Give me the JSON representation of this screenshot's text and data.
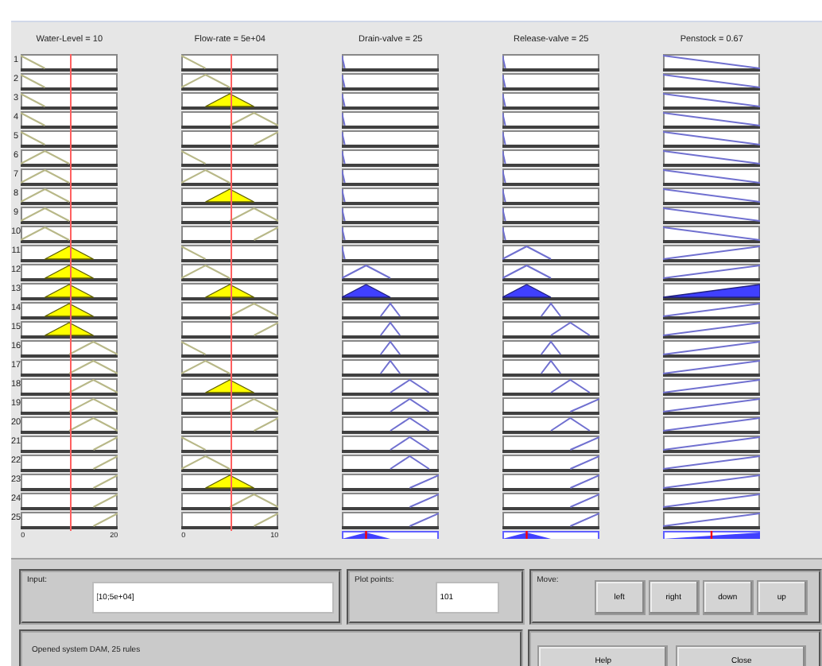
{
  "rule_numbers": [
    "1",
    "2",
    "3",
    "4",
    "5",
    "6",
    "7",
    "8",
    "9",
    "10",
    "11",
    "12",
    "13",
    "14",
    "15",
    "16",
    "17",
    "18",
    "19",
    "20",
    "21",
    "22",
    "23",
    "24",
    "25"
  ],
  "columns": [
    {
      "title": "Water-Level = 10",
      "kind": "input",
      "axis_min": "0",
      "axis_max": "20",
      "rules": [
        {
          "kind": "z",
          "fired": false
        },
        {
          "kind": "z",
          "fired": false
        },
        {
          "kind": "z",
          "fired": false
        },
        {
          "kind": "z",
          "fired": false
        },
        {
          "kind": "z",
          "fired": false
        },
        {
          "kind": "tl",
          "fired": false
        },
        {
          "kind": "tl",
          "fired": false
        },
        {
          "kind": "tl",
          "fired": false
        },
        {
          "kind": "tl",
          "fired": false
        },
        {
          "kind": "tl",
          "fired": false
        },
        {
          "kind": "tm",
          "fired": true
        },
        {
          "kind": "tm",
          "fired": true
        },
        {
          "kind": "tm",
          "fired": true
        },
        {
          "kind": "tm",
          "fired": true
        },
        {
          "kind": "tm",
          "fired": true
        },
        {
          "kind": "tr",
          "fired": false
        },
        {
          "kind": "tr",
          "fired": false
        },
        {
          "kind": "tr",
          "fired": false
        },
        {
          "kind": "tr",
          "fired": false
        },
        {
          "kind": "tr",
          "fired": false
        },
        {
          "kind": "s",
          "fired": false
        },
        {
          "kind": "s",
          "fired": false
        },
        {
          "kind": "s",
          "fired": false
        },
        {
          "kind": "s",
          "fired": false
        },
        {
          "kind": "s",
          "fired": false
        }
      ]
    },
    {
      "title": "Flow-rate = 5e+04",
      "kind": "input",
      "axis_min": "0",
      "axis_max": "10",
      "rules": [
        {
          "kind": "z",
          "fired": false
        },
        {
          "kind": "tl",
          "fired": false
        },
        {
          "kind": "tm",
          "fired": true
        },
        {
          "kind": "tr",
          "fired": false
        },
        {
          "kind": "s",
          "fired": false
        },
        {
          "kind": "z",
          "fired": false
        },
        {
          "kind": "tl",
          "fired": false
        },
        {
          "kind": "tm",
          "fired": true
        },
        {
          "kind": "tr",
          "fired": false
        },
        {
          "kind": "s",
          "fired": false
        },
        {
          "kind": "z",
          "fired": false
        },
        {
          "kind": "tl",
          "fired": false
        },
        {
          "kind": "tm",
          "fired": true
        },
        {
          "kind": "tr",
          "fired": false
        },
        {
          "kind": "s",
          "fired": false
        },
        {
          "kind": "z",
          "fired": false
        },
        {
          "kind": "tl",
          "fired": false
        },
        {
          "kind": "tm",
          "fired": true
        },
        {
          "kind": "tr",
          "fired": false
        },
        {
          "kind": "s",
          "fired": false
        },
        {
          "kind": "z",
          "fired": false
        },
        {
          "kind": "tl",
          "fired": false
        },
        {
          "kind": "tm",
          "fired": true
        },
        {
          "kind": "tr",
          "fired": false
        },
        {
          "kind": "s",
          "fired": false
        }
      ]
    },
    {
      "title": "Drain-valve = 25",
      "kind": "output",
      "rules": [
        {
          "kind": "spike",
          "fired": false
        },
        {
          "kind": "spike",
          "fired": false
        },
        {
          "kind": "spike",
          "fired": false
        },
        {
          "kind": "spike",
          "fired": false
        },
        {
          "kind": "spike",
          "fired": false
        },
        {
          "kind": "spike",
          "fired": false
        },
        {
          "kind": "spike",
          "fired": false
        },
        {
          "kind": "spike",
          "fired": false
        },
        {
          "kind": "spike",
          "fired": false
        },
        {
          "kind": "spike",
          "fired": false
        },
        {
          "kind": "spike",
          "fired": false
        },
        {
          "kind": "low",
          "fired": false
        },
        {
          "kind": "low",
          "fired": true
        },
        {
          "kind": "narrow",
          "fired": false
        },
        {
          "kind": "narrow",
          "fired": false
        },
        {
          "kind": "narrow",
          "fired": false
        },
        {
          "kind": "narrow",
          "fired": false
        },
        {
          "kind": "midhigh",
          "fired": false
        },
        {
          "kind": "midhigh",
          "fired": false
        },
        {
          "kind": "midhigh",
          "fired": false
        },
        {
          "kind": "midhigh",
          "fired": false
        },
        {
          "kind": "midhigh",
          "fired": false
        },
        {
          "kind": "high",
          "fired": false
        },
        {
          "kind": "high",
          "fired": false
        },
        {
          "kind": "high",
          "fired": false
        }
      ]
    },
    {
      "title": "Release-valve = 25",
      "kind": "output",
      "rules": [
        {
          "kind": "spike",
          "fired": false
        },
        {
          "kind": "spike",
          "fired": false
        },
        {
          "kind": "spike",
          "fired": false
        },
        {
          "kind": "spike",
          "fired": false
        },
        {
          "kind": "spike",
          "fired": false
        },
        {
          "kind": "spike",
          "fired": false
        },
        {
          "kind": "spike",
          "fired": false
        },
        {
          "kind": "spike",
          "fired": false
        },
        {
          "kind": "spike",
          "fired": false
        },
        {
          "kind": "spike",
          "fired": false
        },
        {
          "kind": "low",
          "fired": false
        },
        {
          "kind": "low",
          "fired": false
        },
        {
          "kind": "low",
          "fired": true
        },
        {
          "kind": "narrow",
          "fired": false
        },
        {
          "kind": "midhigh",
          "fired": false
        },
        {
          "kind": "narrow",
          "fired": false
        },
        {
          "kind": "narrow",
          "fired": false
        },
        {
          "kind": "midhigh",
          "fired": false
        },
        {
          "kind": "high",
          "fired": false
        },
        {
          "kind": "midhigh",
          "fired": false
        },
        {
          "kind": "high",
          "fired": false
        },
        {
          "kind": "high",
          "fired": false
        },
        {
          "kind": "high",
          "fired": false
        },
        {
          "kind": "high",
          "fired": false
        },
        {
          "kind": "high",
          "fired": false
        }
      ]
    },
    {
      "title": "Penstock = 0.67",
      "kind": "output",
      "rules": [
        {
          "kind": "fall",
          "fired": false
        },
        {
          "kind": "fall",
          "fired": false
        },
        {
          "kind": "fall",
          "fired": false
        },
        {
          "kind": "fall",
          "fired": false
        },
        {
          "kind": "fall",
          "fired": false
        },
        {
          "kind": "fall",
          "fired": false
        },
        {
          "kind": "fall",
          "fired": false
        },
        {
          "kind": "fall",
          "fired": false
        },
        {
          "kind": "fall",
          "fired": false
        },
        {
          "kind": "fall",
          "fired": false
        },
        {
          "kind": "rise",
          "fired": false
        },
        {
          "kind": "rise",
          "fired": false
        },
        {
          "kind": "rise",
          "fired": true
        },
        {
          "kind": "rise",
          "fired": false
        },
        {
          "kind": "rise",
          "fired": false
        },
        {
          "kind": "rise",
          "fired": false
        },
        {
          "kind": "rise",
          "fired": false
        },
        {
          "kind": "rise",
          "fired": false
        },
        {
          "kind": "rise",
          "fired": false
        },
        {
          "kind": "rise",
          "fired": false
        },
        {
          "kind": "rise",
          "fired": false
        },
        {
          "kind": "rise",
          "fired": false
        },
        {
          "kind": "rise",
          "fired": false
        },
        {
          "kind": "rise",
          "fired": false
        },
        {
          "kind": "rise",
          "fired": false
        }
      ]
    }
  ],
  "input": {
    "label": "Input:",
    "value": "[10;5e+04]"
  },
  "plot_points": {
    "label": "Plot points:",
    "value": "101"
  },
  "move": {
    "label": "Move:",
    "buttons": [
      "left",
      "right",
      "down",
      "up"
    ]
  },
  "status": "Opened system DAM, 25 rules",
  "buttons": [
    "Help",
    "Close"
  ]
}
